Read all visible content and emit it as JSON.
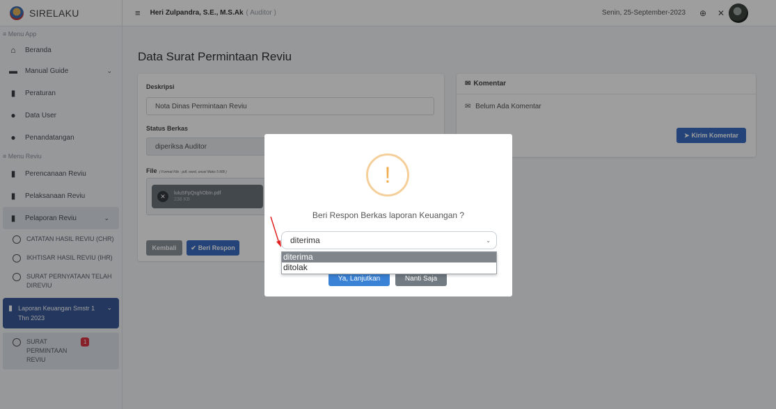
{
  "app": {
    "brand": "SIRELAKU"
  },
  "topbar": {
    "user_name": "Heri Zulpandra, S.E., M.S.Ak",
    "user_role": "( Auditor )",
    "date": "Senin, 25-September-2023"
  },
  "sidebar": {
    "header_app": "≡ Menu App",
    "header_reviu": "≡ Menu Reviu",
    "items": [
      {
        "label": "Beranda",
        "icon": "home-icon"
      },
      {
        "label": "Manual Guide",
        "icon": "book-icon"
      },
      {
        "label": "Peraturan",
        "icon": "bookmark-icon"
      },
      {
        "label": "Data User",
        "icon": "users-icon"
      },
      {
        "label": "Penandatangan",
        "icon": "user-icon"
      },
      {
        "label": "Perencanaan Reviu",
        "icon": "file-icon"
      },
      {
        "label": "Pelaksanaan Reviu",
        "icon": "file-icon"
      },
      {
        "label": "Pelaporan Reviu",
        "icon": "file-icon"
      }
    ],
    "subs_pelaporan": [
      "CATATAN HASIL REVIU (CHR)",
      "IKHTISAR HASIL REVIU (IHR)",
      "SURAT PERNYATAAN TELAH DIREVIU"
    ],
    "active_group": "Laporan Keuangan Smstr 1 Thn 2023",
    "active_sub": "SURAT PERMINTAAN REVIU",
    "active_badge": "1"
  },
  "page": {
    "title": "Data Surat Permintaan Reviu",
    "form": {
      "deskripsi_label": "Deskripsi",
      "deskripsi_value": "Nota Dinas Permintaan Reviu",
      "status_label": "Status Berkas",
      "status_value": "diperiksa Auditor",
      "file_label": "File",
      "file_hint": "( Format File : pdf, word, excel Maks 5 MB )",
      "file_name": "luluSFpQsghObIn.pdf",
      "file_size": "238 KB",
      "back_button": "Kembali",
      "respond_button": "Beri Respon"
    },
    "comments": {
      "title": "Komentar",
      "empty": "Belum Ada Komentar",
      "send_button": "Kirim Komentar"
    }
  },
  "modal": {
    "title": "Beri Respon Berkas laporan Keuangan ?",
    "selected": "diterima",
    "options": [
      "diterima",
      "ditolak"
    ],
    "confirm_button": "Ya, Lanjutkan",
    "cancel_button": "Nanti Saja"
  },
  "colors": {
    "accent": "#3b5a9a",
    "primary": "#3a6fc4",
    "warning": "#f0ad4e",
    "danger": "#dc3545"
  }
}
